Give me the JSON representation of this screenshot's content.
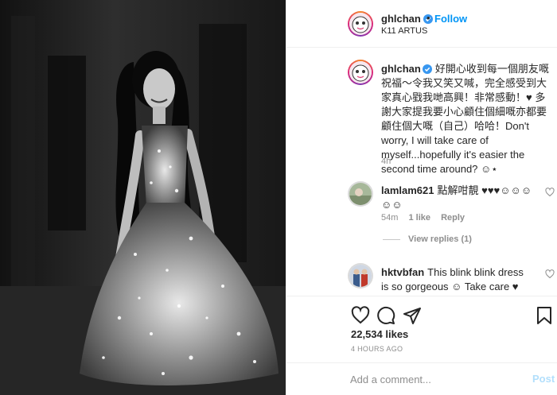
{
  "post": {
    "image_alt": "Black and white photo of a woman in a sparkling sequined gown"
  },
  "header": {
    "username": "ghlchan",
    "separator": "•",
    "follow_label": "Follow",
    "location": "K11 ARTUS"
  },
  "caption": {
    "username": "ghlchan",
    "text": "好開心收到每一個朋友嘅祝福～令我又笑又喊，完全感受到大家真心戥我哋高興！非常感動！♥ 多謝大家提我要小心顧住個細嘅亦都要顧住個大嘅（自己）哈哈！Don't worry, I will take care of myself...hopefully it's easier the second time around? ☺⋆",
    "time": "4h"
  },
  "comments": [
    {
      "username": "lamlam621",
      "text": "點解咁靚 ♥♥♥☺☺☺☺☺",
      "time": "54m",
      "likes": "1 like",
      "reply_label": "Reply"
    },
    {
      "username": "hktvbfan",
      "text": "This blink blink dress is so gorgeous ☺ Take care ♥"
    }
  ],
  "view_replies_label": "View replies (1)",
  "likes_count": "22,534 likes",
  "time_ago": "4 HOURS AGO",
  "add_comment": {
    "placeholder": "Add a comment...",
    "post_label": "Post"
  },
  "colors": {
    "accent_blue": "#0095f6",
    "post_disabled": "#b2dffc",
    "muted": "#8e8e8e",
    "text": "#262626"
  },
  "icons": [
    "verified-badge-icon",
    "heart-icon",
    "comment-icon",
    "share-icon",
    "bookmark-icon"
  ]
}
